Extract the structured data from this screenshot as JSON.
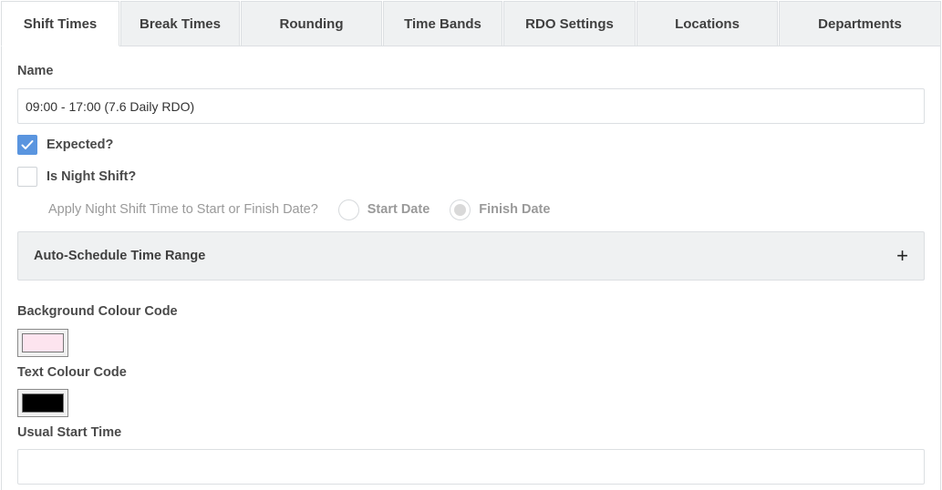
{
  "tabs": [
    {
      "label": "Shift Times",
      "active": true
    },
    {
      "label": "Break Times",
      "active": false
    },
    {
      "label": "Rounding",
      "active": false
    },
    {
      "label": "Time Bands",
      "active": false
    },
    {
      "label": "RDO Settings",
      "active": false
    },
    {
      "label": "Locations",
      "active": false
    },
    {
      "label": "Departments",
      "active": false
    }
  ],
  "form": {
    "name_label": "Name",
    "name_value": "09:00 - 17:00 (7.6 Daily RDO)",
    "expected_label": "Expected?",
    "expected_checked": true,
    "night_shift_label": "Is Night Shift?",
    "night_shift_checked": false,
    "apply_night_label": "Apply Night Shift Time to Start or Finish Date?",
    "start_date_label": "Start Date",
    "finish_date_label": "Finish Date",
    "selected_date_option": "Finish Date",
    "auto_schedule_label": "Auto-Schedule Time Range",
    "auto_schedule_icon": "plus-icon",
    "bg_colour_label": "Background Colour Code",
    "bg_colour_value": "#fde4ef",
    "text_colour_label": "Text Colour Code",
    "text_colour_value": "#000000",
    "usual_start_label": "Usual Start Time",
    "usual_start_value": ""
  },
  "colors": {
    "accent": "#5a95df",
    "tab_bg": "#eff1f2",
    "border": "#dcdfe2"
  }
}
